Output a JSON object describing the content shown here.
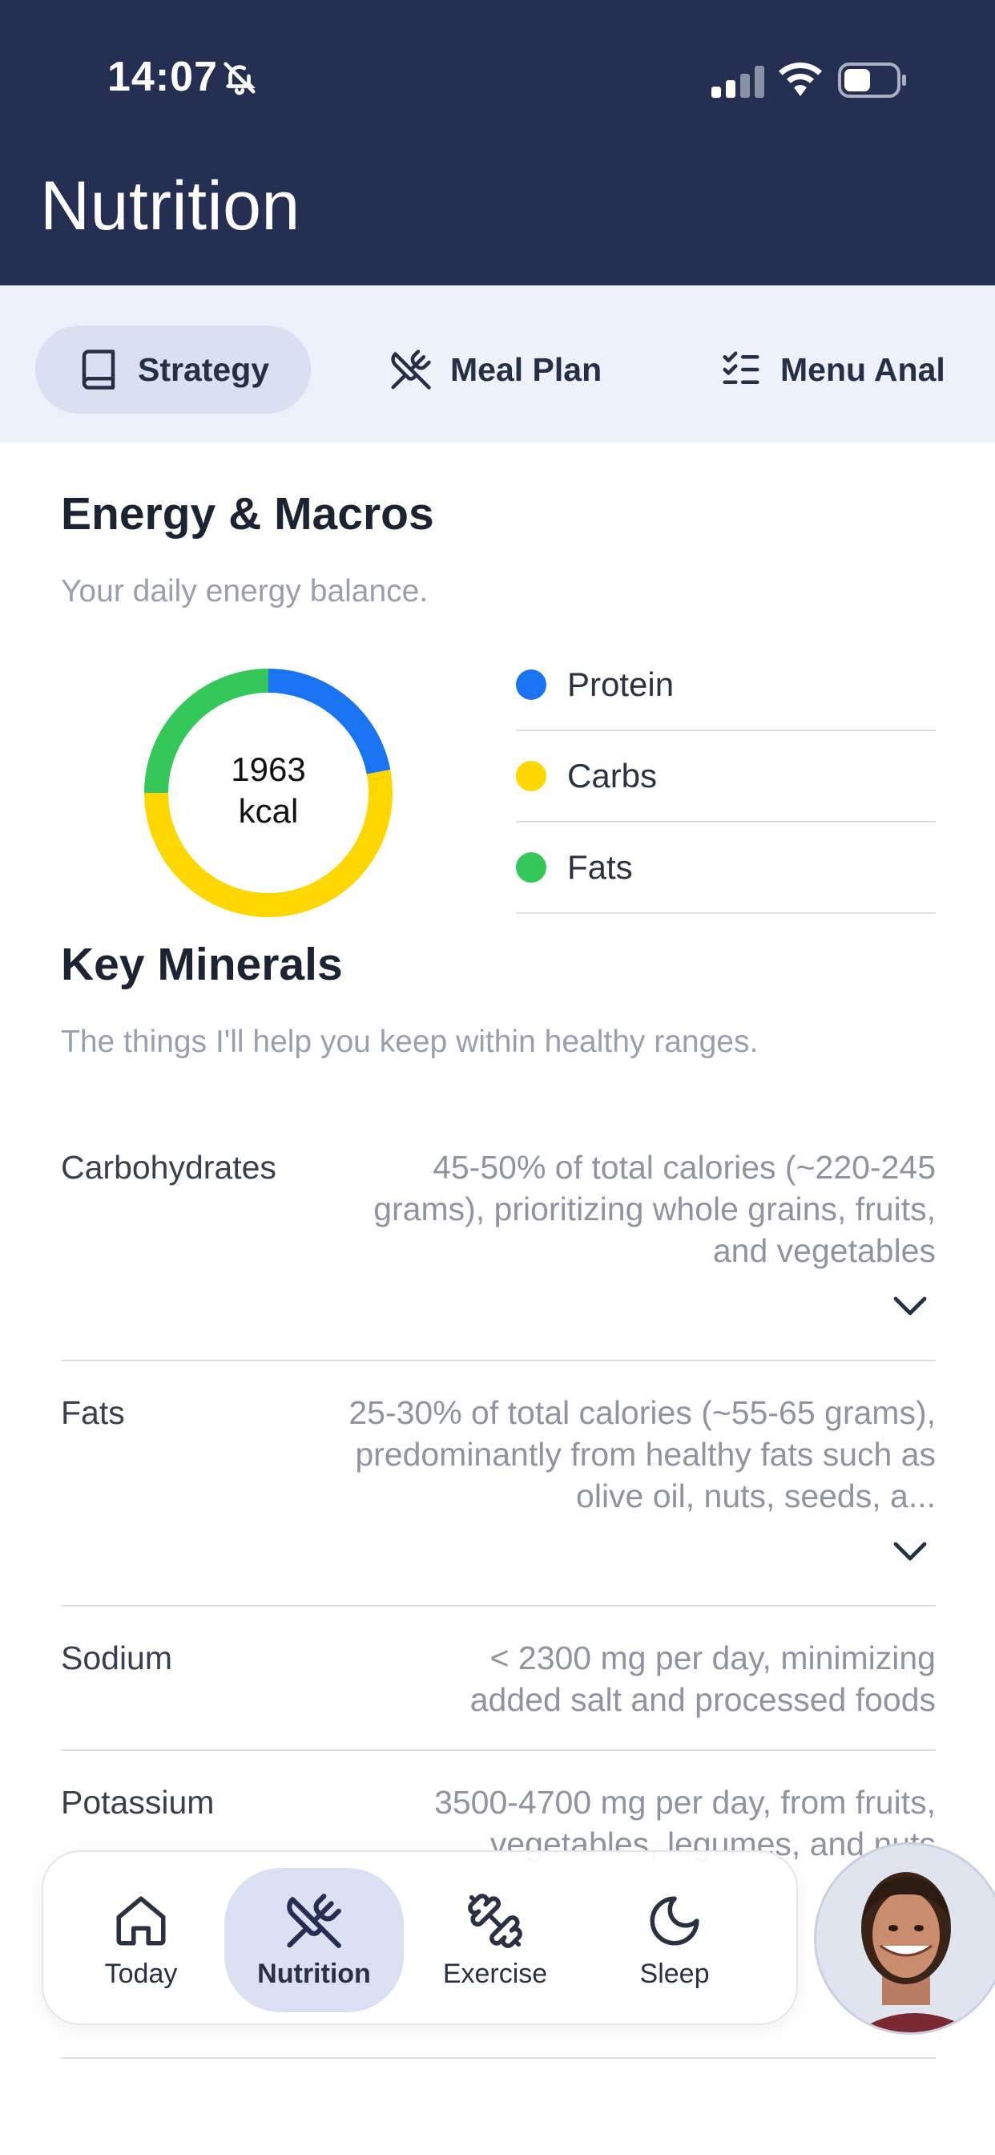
{
  "status": {
    "time": "14:07"
  },
  "header": {
    "title": "Nutrition"
  },
  "tabs": [
    {
      "label": "Strategy",
      "icon": "book-icon",
      "active": true
    },
    {
      "label": "Meal Plan",
      "icon": "utensils-crossed-icon",
      "active": false
    },
    {
      "label": "Menu Anal",
      "icon": "list-checks-icon",
      "active": false
    }
  ],
  "energy": {
    "title": "Energy & Macros",
    "subtitle": "Your daily energy balance.",
    "calories_value": "1963",
    "calories_unit": "kcal",
    "macros": [
      {
        "label": "Protein",
        "color": "#1a73f0",
        "fraction": 0.22
      },
      {
        "label": "Carbs",
        "color": "#ffd700",
        "fraction": 0.53
      },
      {
        "label": "Fats",
        "color": "#34c759",
        "fraction": 0.25
      }
    ]
  },
  "minerals": {
    "title": "Key Minerals",
    "subtitle": "The things I'll help you keep within healthy ranges.",
    "items": [
      {
        "name": "Carbohydrates",
        "desc": "45-50% of total calories (~220-245 grams), prioritizing whole grains, fruits, and vegetables"
      },
      {
        "name": "Fats",
        "desc": "25-30% of total calories (~55-65 grams), predominantly from healthy fats such as olive oil, nuts, seeds, a..."
      },
      {
        "name": "Sodium",
        "desc": "< 2300 mg per day, minimizing added salt and processed foods"
      },
      {
        "name": "Potassium",
        "desc": "3500-4700 mg per day, from fruits, vegetables, legumes, and nuts"
      }
    ]
  },
  "bottom_nav": [
    {
      "label": "Today",
      "icon": "home-icon",
      "active": false
    },
    {
      "label": "Nutrition",
      "icon": "utensils-crossed-icon",
      "active": true
    },
    {
      "label": "Exercise",
      "icon": "dumbbell-icon",
      "active": false
    },
    {
      "label": "Sleep",
      "icon": "moon-icon",
      "active": false
    }
  ]
}
